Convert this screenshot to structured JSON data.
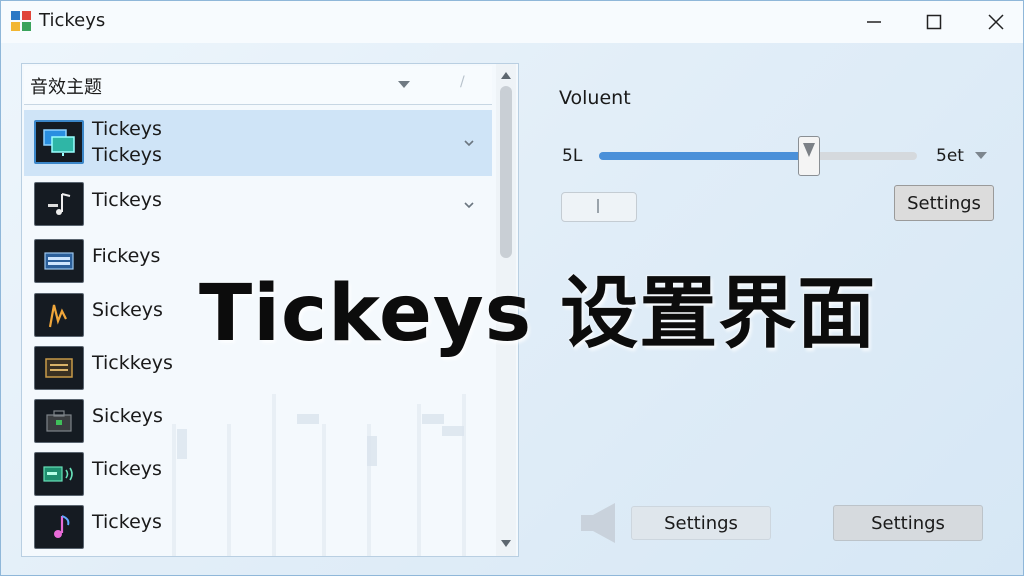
{
  "window": {
    "title": "Tickeys",
    "icon": "app-grid-icon",
    "controls": [
      "minimize-icon",
      "maximize-icon",
      "close-icon"
    ]
  },
  "sound_panel": {
    "dropdown_label": "音效主题",
    "items": [
      {
        "line1": "Tickeys",
        "line2": "Tickeys",
        "selected": true,
        "icon": "monitor-icon",
        "chevron": true
      },
      {
        "line1": "Tickeys",
        "selected": false,
        "icon": "music-note-icon",
        "chevron": true
      },
      {
        "line1": "Fickeys",
        "selected": false,
        "icon": "keyboard-icon"
      },
      {
        "line1": "Sickeys",
        "selected": false,
        "icon": "wave-icon"
      },
      {
        "line1": "Tickkeys",
        "selected": false,
        "icon": "typewriter-icon"
      },
      {
        "line1": "Sickeys",
        "selected": false,
        "icon": "briefcase-icon"
      },
      {
        "line1": "Tickeys",
        "selected": false,
        "icon": "speaker-device-icon"
      },
      {
        "line1": "Tickeys",
        "selected": false,
        "icon": "music-note-pink-icon"
      }
    ]
  },
  "volume": {
    "label": "Voluent",
    "min_label": "5L",
    "max_label": "5et",
    "level_fraction": 0.66
  },
  "buttons": {
    "settings_top": "Settings",
    "settings_bottom_left": "Settings",
    "settings_bottom_right": "Settings"
  },
  "overlay": {
    "title": "Tickeys 设置界面"
  },
  "colors": {
    "accent": "#4a90d9",
    "selection": "#cfe4f7",
    "background": "#e2eef8"
  }
}
